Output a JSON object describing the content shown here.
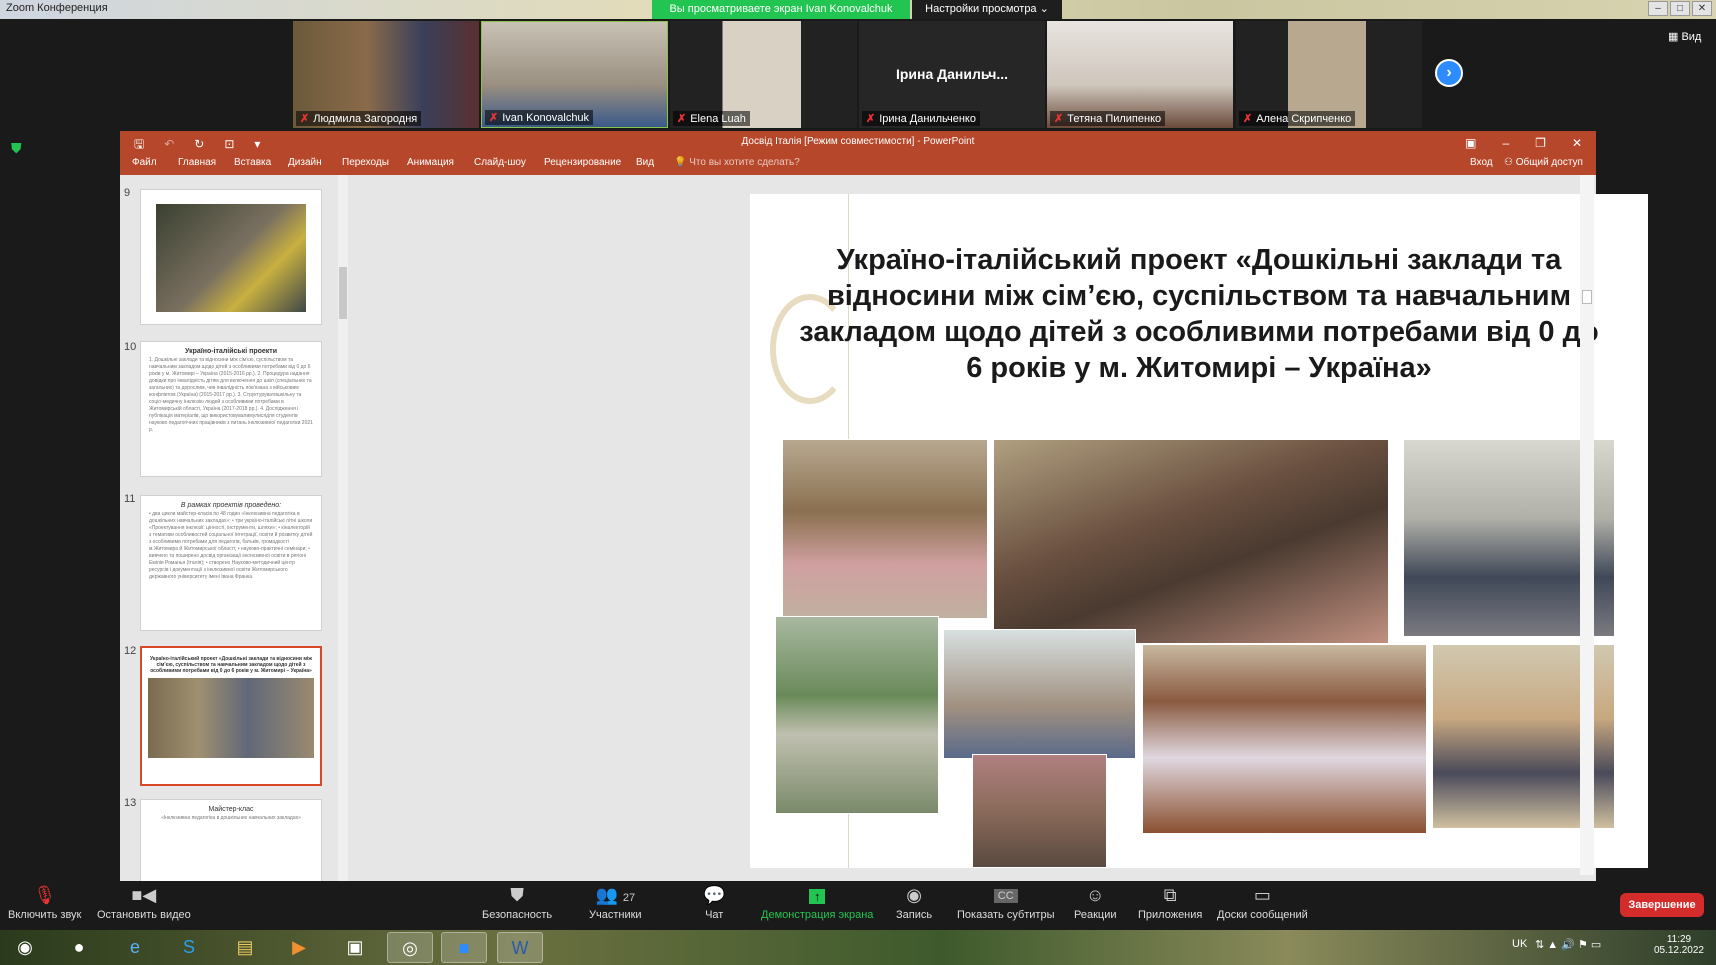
{
  "zoom": {
    "window_title": "Zoom Конференция",
    "share_banner": "Вы просматриваете экран Ivan Konovalchuk",
    "view_options": "Настройки просмотра ⌄",
    "view_button": "Вид",
    "participants": [
      {
        "name": "Людмила Загородня"
      },
      {
        "name": "Ivan Konovalchuk"
      },
      {
        "name": "Elena Luah"
      },
      {
        "name": "Ірина Данильченко",
        "placeholder": "Ірина  Данильч..."
      },
      {
        "name": "Тетяна Пилипенко"
      },
      {
        "name": "Алена Скрипченко"
      }
    ],
    "toolbar": {
      "mute": "Включить звук",
      "video": "Остановить видео",
      "security": "Безопасность",
      "participants": "Участники",
      "participants_count": "27",
      "chat": "Чат",
      "share": "Демонстрация экрана",
      "record": "Запись",
      "captions": "Показать субтитры",
      "reactions": "Реакции",
      "apps": "Приложения",
      "whiteboards": "Доски сообщений",
      "end": "Завершение"
    }
  },
  "ppt": {
    "title": "Досвід Італія [Режим совместимости] - PowerPoint",
    "tabs": [
      "Файл",
      "Главная",
      "Вставка",
      "Дизайн",
      "Переходы",
      "Анимация",
      "Слайд-шоу",
      "Рецензирование",
      "Вид"
    ],
    "tell_me": "Что вы хотите сделать?",
    "signin": "Вход",
    "share": "Общий доступ",
    "thumbnails": [
      {
        "num": "9",
        "title": ""
      },
      {
        "num": "10",
        "title": "Україно-італійські проекти",
        "body": "1. Дошкільні заклади та відносини між сім'єю, суспільством та навчальним закладом щодо дітей з особливими потребами від 0 до 6 років у м. Житомирі – Україна (2015-2016 рр.). 2. Процедура надання довідки про інвалідність дітям для включення до шкіл (спеціальних та загальних) та дорослим, чия інвалідність пов'язана з військовим конфліктом (Україна) (2015-2017 рр.). 3. Структуруватишкільну та соціо-медичну інклюзію людей з особливими потребами в Житомирській області, Україна (2017-2018 рр.). 4. Дослідження і публікація матеріалів, що використовувалимулисядля студентів науково педагогічних працівників з питань інклюзивної педагогіки 2021 р."
      },
      {
        "num": "11",
        "title": "В рамках проектів проведено:",
        "body": "• два цикли майстер-класів по 48 годин «Інклюзивна педагогіка в дошкільних навчальних закладах»; • три україно-італійські літні школи «Проектування інклюзії: цінності, інструменти, шляхи»; • кіналекторій з тематики особливостей соціальної інтеграції, освіти й розвитку дітей з особливими потребами для педагогів, батьків, громадкості м.Житомира й Житомирської області; • науково-практичні семінари; • вивчено та поширено досвід організації інклюзивної освіти в регіоні Емілія Романья (Італія); • створено Науково-методичний центр ресурсів і документації з інклюзивної освіти Житомирського державного університету імені Івана Франка."
      },
      {
        "num": "12",
        "title": "Україно-італійський проект «Дошкільні заклади та відносини між сім'єю, суспільством та навчальним закладом щодо дітей з особливими потребами від 0 до 6 років у м. Житомирі – Україна»"
      },
      {
        "num": "13",
        "title": "Майстер-клас",
        "body": "«Інклюзивна педагогіка в дошкільних навчальних закладах»"
      }
    ],
    "slide_title": "Україно-італійський проект «Дошкільні заклади та відносини між сім’єю, суспільством та навчальним закладом щодо дітей з особливими потребами від 0 до 6 років у м. Житомирі – Україна»"
  },
  "taskbar": {
    "lang": "UK",
    "time": "11:29",
    "date": "05.12.2022"
  }
}
